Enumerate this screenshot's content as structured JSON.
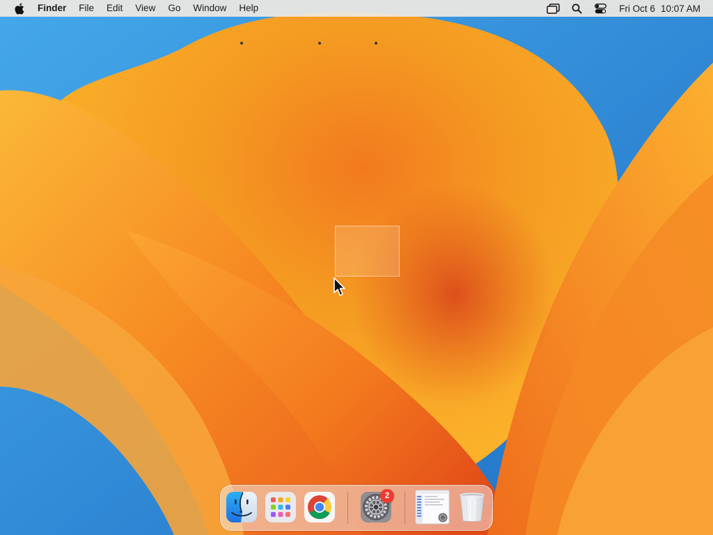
{
  "menubar": {
    "apple_icon": "apple-logo-icon",
    "app_name": "Finder",
    "menus": [
      "File",
      "Edit",
      "View",
      "Go",
      "Window",
      "Help"
    ],
    "status_icons": [
      "screen-mirroring-icon",
      "spotlight-search-icon",
      "control-center-icon"
    ],
    "date": "Fri Oct 6",
    "time": "10:07 AM"
  },
  "desktop": {
    "wallpaper": "macOS Ventura orange wallpaper",
    "selection_marquee": true
  },
  "dock": {
    "apps": [
      {
        "name": "Finder",
        "icon": "finder-icon",
        "running": true
      },
      {
        "name": "Launchpad",
        "icon": "launchpad-icon",
        "running": false
      },
      {
        "name": "Google Chrome",
        "icon": "chrome-icon",
        "running": true
      },
      {
        "name": "System Settings",
        "icon": "system-settings-icon",
        "running": true,
        "badge": "2"
      },
      {
        "name": "Downloads",
        "icon": "downloads-stack-icon",
        "running": false
      },
      {
        "name": "Trash",
        "icon": "trash-icon",
        "running": false
      }
    ]
  },
  "colors": {
    "accent_orange": "#f5861e",
    "sky_blue": "#2f86d6",
    "badge_red": "#f03a30"
  }
}
